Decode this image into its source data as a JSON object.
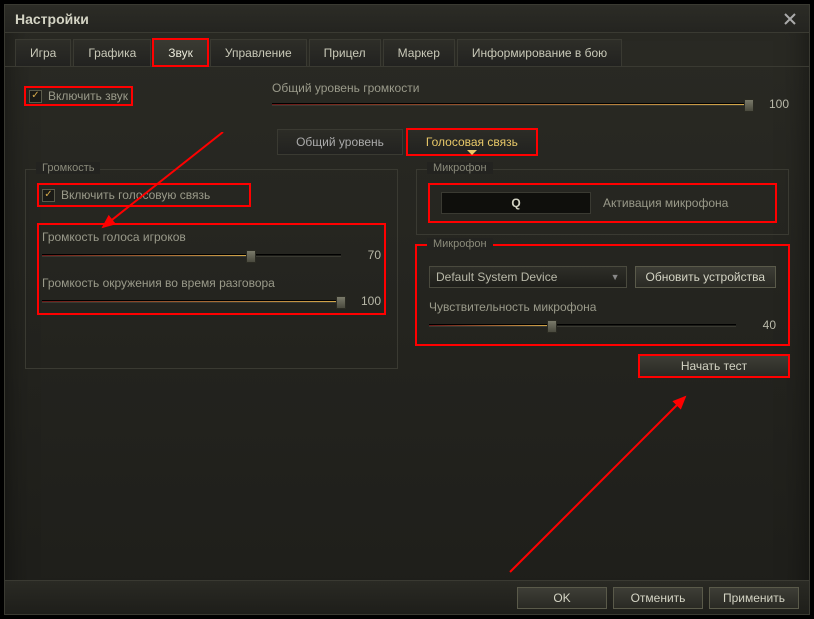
{
  "window": {
    "title": "Настройки"
  },
  "tabs": [
    {
      "label": "Игра"
    },
    {
      "label": "Графика"
    },
    {
      "label": "Звук",
      "active": true
    },
    {
      "label": "Управление"
    },
    {
      "label": "Прицел"
    },
    {
      "label": "Маркер"
    },
    {
      "label": "Информирование в бою"
    }
  ],
  "enable_sound": {
    "label": "Включить звук",
    "checked": true
  },
  "master_volume": {
    "label": "Общий уровень громкости",
    "value": 100
  },
  "subtabs": [
    {
      "label": "Общий уровень"
    },
    {
      "label": "Голосовая связь",
      "active": true
    }
  ],
  "left": {
    "fieldset_title": "Громкость",
    "enable_voice": {
      "label": "Включить голосовую связь",
      "checked": true
    },
    "voice_volume": {
      "label": "Громкость голоса игроков",
      "value": 70
    },
    "ambient_volume": {
      "label": "Громкость окружения во время разговора",
      "value": 100
    }
  },
  "right": {
    "mic_fieldset_title": "Микрофон",
    "keybind": {
      "key": "Q",
      "label": "Активация микрофона"
    },
    "mic_device_label": "Микрофон",
    "mic_device_value": "Default System Device",
    "refresh_btn": "Обновить устройства",
    "sensitivity": {
      "label": "Чувствительность микрофона",
      "value": 40
    },
    "start_test_btn": "Начать тест"
  },
  "footer": {
    "ok": "OK",
    "cancel": "Отменить",
    "apply": "Применить"
  }
}
